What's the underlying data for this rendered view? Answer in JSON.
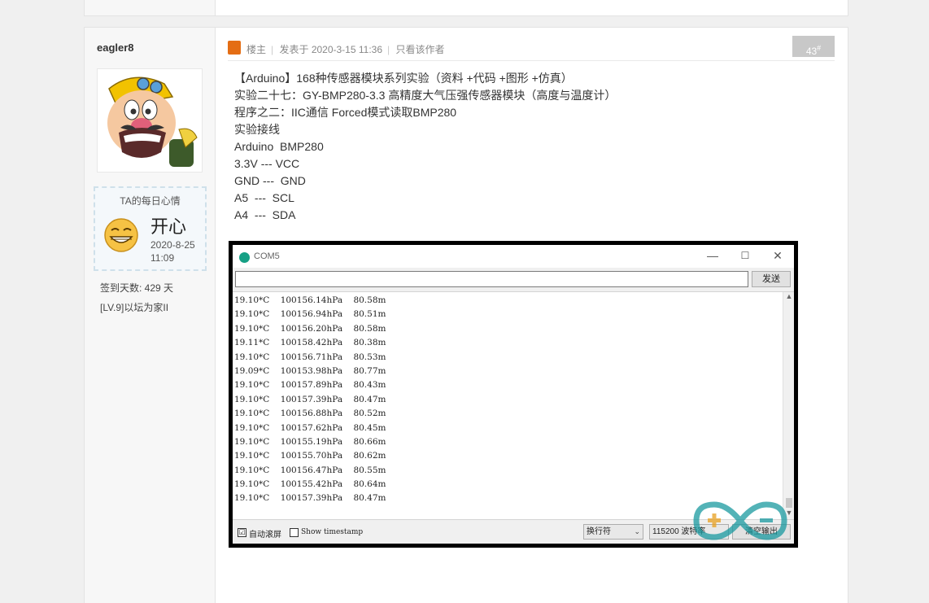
{
  "author": {
    "username": "eagler8",
    "mood_title": "TA的每日心情",
    "mood_text": "开心",
    "mood_date": "2020-8-25 11:09",
    "sign_days": "签到天数: 429 天",
    "level": "[LV.9]以坛为家II"
  },
  "post_header": {
    "role": "楼主",
    "posted": "发表于 2020-3-15 11:36",
    "only_author": "只看该作者",
    "floor_number": "43",
    "floor_sup": "#"
  },
  "content_lines": [
    "【Arduino】168种传感器模块系列实验（资料 +代码 +图形 +仿真）",
    "实验二十七：GY-BMP280-3.3 高精度大气压强传感器模块（高度与温度计）",
    "程序之二：IIC通信 Forced模式读取BMP280",
    "实验接线",
    "Arduino  BMP280",
    "3.3V --- VCC",
    "GND ---  GND",
    "A5  ---  SCL",
    "A4  ---  SDA"
  ],
  "serial_window": {
    "title": "COM5",
    "send_label": "发送",
    "lines": [
      "19.10*C    100156.14hPa    80.58m",
      "19.10*C    100156.94hPa    80.51m",
      "19.10*C    100156.20hPa    80.58m",
      "19.11*C    100158.42hPa    80.38m",
      "19.10*C    100156.71hPa    80.53m",
      "19.09*C    100153.98hPa    80.77m",
      "19.10*C    100157.89hPa    80.43m",
      "19.10*C    100157.39hPa    80.47m",
      "19.10*C    100156.88hPa    80.52m",
      "19.10*C    100157.62hPa    80.45m",
      "19.10*C    100155.19hPa    80.66m",
      "19.10*C    100155.70hPa    80.62m",
      "19.10*C    100156.47hPa    80.55m",
      "19.10*C    100155.42hPa    80.64m",
      "19.10*C    100157.39hPa    80.47m"
    ],
    "autoscroll_label": "自动滚屏",
    "autoscroll_checked": "☑",
    "timestamp_label": "Show timestamp",
    "line_ending": "换行符",
    "baud": "115200 波特率",
    "clear_label": "清空输出"
  },
  "colors": {
    "host_icon": "#e46d14",
    "arduino_teal": "#16a085"
  }
}
